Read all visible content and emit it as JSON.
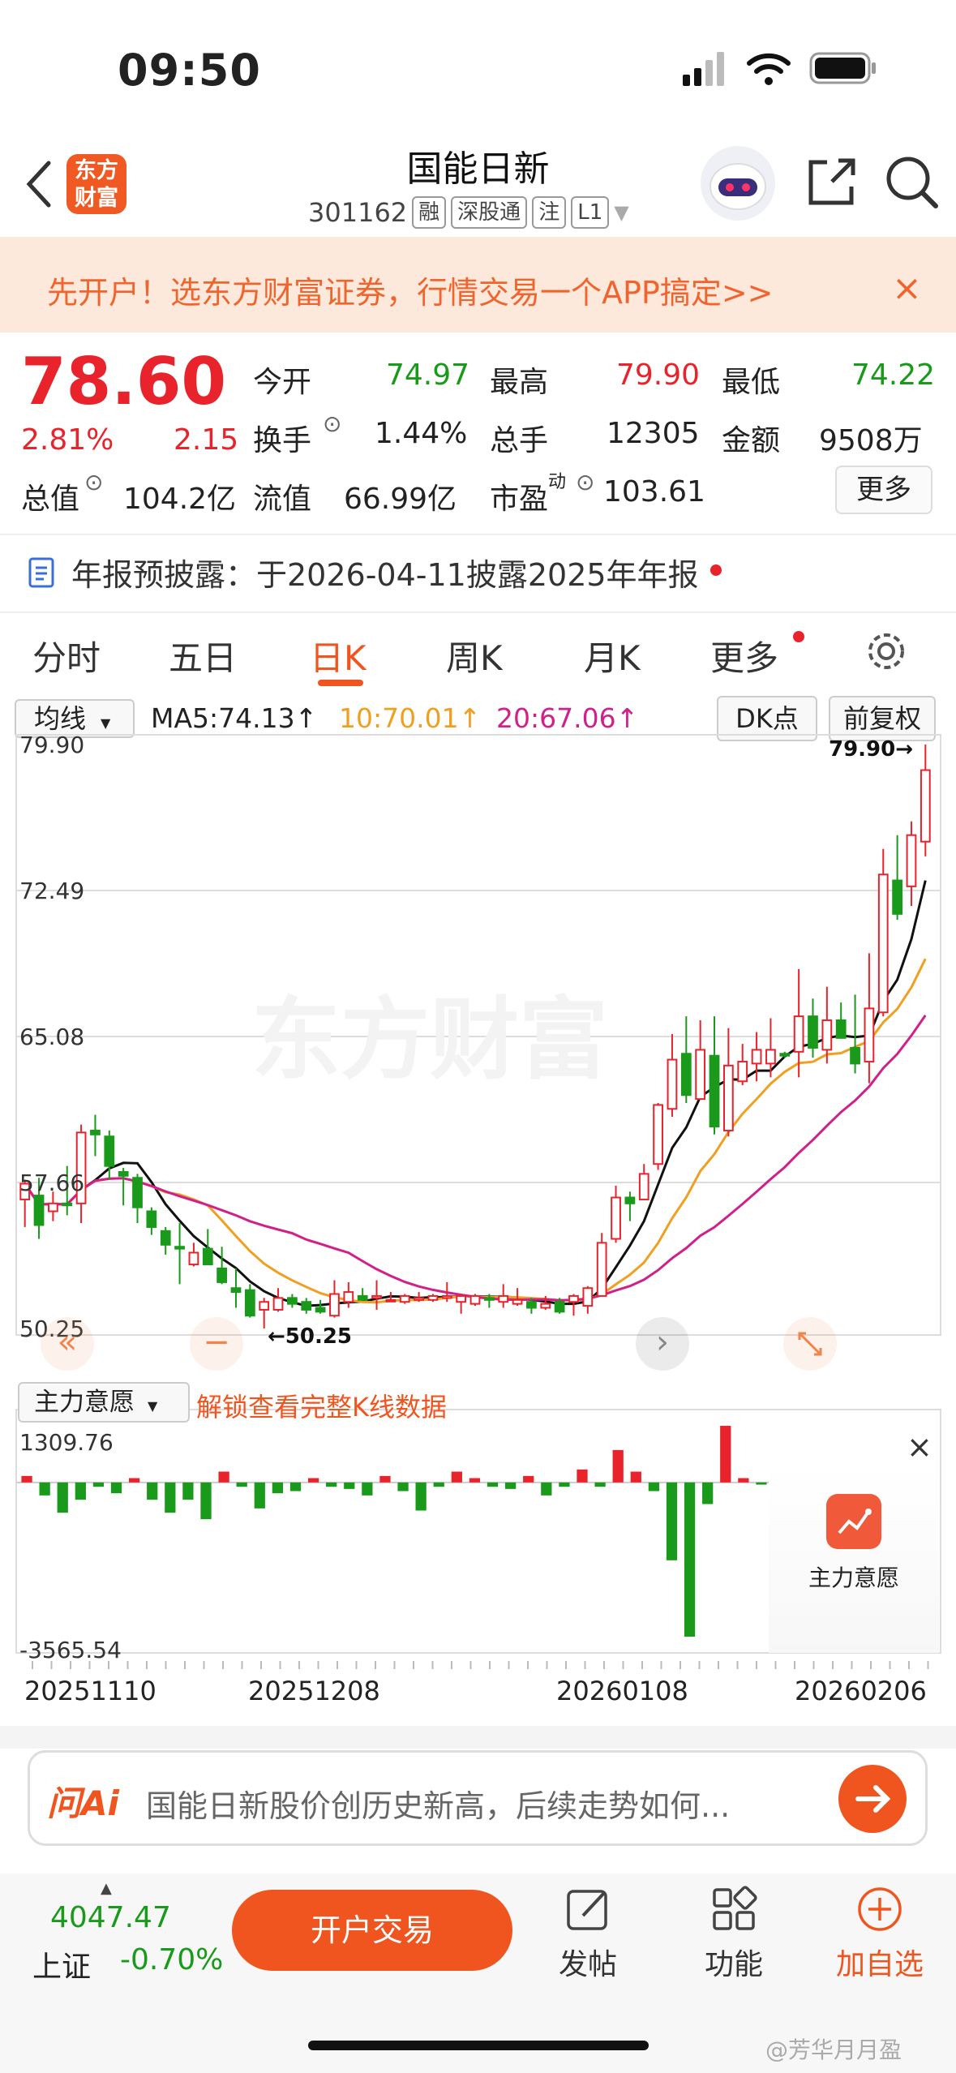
{
  "status": {
    "time": "09:50"
  },
  "header": {
    "title": "国能日新",
    "code": "301162",
    "tags": [
      "融",
      "深股通",
      "注",
      "L1"
    ],
    "logo": "东方\n财富"
  },
  "banner": {
    "text": "先开户！选东方财富证券，行情交易一个APP搞定>>",
    "close": "×"
  },
  "quote": {
    "price": "78.60",
    "pct": "2.81%",
    "chg": "2.15",
    "open_label": "今开",
    "open": "74.97",
    "high_label": "最高",
    "high": "79.90",
    "low_label": "最低",
    "low": "74.22",
    "turnover_label": "换手",
    "turnover": "1.44%",
    "vol_label": "总手",
    "vol": "12305",
    "amount_label": "金额",
    "amount": "9508万",
    "cap_label": "总值",
    "cap": "104.2亿",
    "float_label": "流值",
    "float": "66.99亿",
    "pe_label": "市盈",
    "pe_sup": "动",
    "pe": "103.61",
    "more": "更多"
  },
  "notice": {
    "text": "年报预披露：于2026-04-11披露2025年年报"
  },
  "tabs": [
    "分时",
    "五日",
    "日K",
    "周K",
    "月K",
    "更多"
  ],
  "active_tab": "日K",
  "ma": {
    "select": "均线",
    "ma5": "MA5:74.13↑",
    "ma10": "10:70.01↑",
    "ma20": "20:67.06↑",
    "dk": "DK点",
    "fq": "前复权"
  },
  "axis": {
    "y_labels": [
      "79.90",
      "72.49",
      "65.08",
      "57.66",
      "50.25"
    ],
    "max_mark": "79.90→",
    "min_mark": "←50.25"
  },
  "watermark": "东方财富",
  "sub": {
    "select": "主力意愿",
    "unlock": "解锁查看完整K线数据",
    "top": "1309.76",
    "bottom": "-3565.54",
    "badge": "主力意愿",
    "close": "×"
  },
  "dates": [
    "20251110",
    "20251208",
    "20260108",
    "20260206"
  ],
  "ai": {
    "brand": "问Ai",
    "text": "国能日新股价创历史新高，后续走势如何..."
  },
  "footer": {
    "index": "4047.47",
    "index_name": "上证",
    "index_pct": "-0.70%",
    "trade": "开户交易",
    "post": "发帖",
    "func": "功能",
    "add": "加自选"
  },
  "credit": "@芳华月月盈",
  "colors": {
    "up": "#e8232b",
    "down": "#1a9a1a",
    "accent": "#f0551f",
    "ma5": "#111111",
    "ma10": "#f0a020",
    "ma20": "#d0208a"
  },
  "chart_data": {
    "type": "candlestick",
    "ylim": [
      50.25,
      79.9
    ],
    "candles": [
      [
        56.8,
        57.6,
        55.4,
        57.8
      ],
      [
        57.0,
        55.5,
        54.8,
        57.9
      ],
      [
        56.2,
        56.6,
        55.7,
        57.2
      ],
      [
        56.6,
        56.5,
        56.0,
        58.5
      ],
      [
        56.6,
        60.2,
        55.6,
        60.6
      ],
      [
        60.3,
        60.1,
        59.0,
        61.1
      ],
      [
        60.0,
        58.5,
        57.8,
        60.3
      ],
      [
        58.2,
        58.0,
        56.5,
        58.4
      ],
      [
        57.9,
        56.4,
        55.6,
        58.1
      ],
      [
        56.2,
        55.4,
        55.0,
        56.4
      ],
      [
        55.2,
        54.5,
        54.0,
        55.4
      ],
      [
        54.4,
        54.3,
        52.5,
        55.6
      ],
      [
        53.5,
        54.1,
        53.4,
        54.6
      ],
      [
        54.3,
        53.5,
        53.5,
        55.3
      ],
      [
        53.3,
        52.6,
        52.5,
        54.4
      ],
      [
        52.3,
        52.1,
        51.3,
        53.3
      ],
      [
        52.2,
        50.9,
        50.8,
        52.5
      ],
      [
        51.2,
        51.6,
        50.25,
        51.8
      ],
      [
        51.2,
        51.8,
        51.1,
        52.3
      ],
      [
        51.8,
        51.5,
        51.3,
        52.0
      ],
      [
        51.6,
        51.2,
        51.0,
        51.8
      ],
      [
        51.3,
        51.1,
        51.0,
        51.7
      ],
      [
        50.9,
        52.0,
        50.8,
        52.7
      ],
      [
        51.6,
        52.1,
        51.3,
        52.6
      ],
      [
        51.9,
        51.7,
        51.7,
        52.3
      ],
      [
        51.8,
        51.9,
        51.2,
        52.7
      ],
      [
        51.7,
        51.7,
        51.6,
        52.1
      ],
      [
        51.6,
        51.9,
        51.5,
        52.0
      ],
      [
        51.7,
        51.8,
        51.6,
        52.1
      ],
      [
        51.7,
        51.9,
        51.6,
        52.0
      ],
      [
        51.8,
        51.9,
        51.6,
        52.6
      ],
      [
        51.6,
        51.9,
        51.0,
        52.0
      ],
      [
        51.5,
        51.9,
        51.4,
        52.0
      ],
      [
        51.8,
        51.7,
        51.3,
        52.0
      ],
      [
        51.6,
        51.9,
        51.3,
        52.5
      ],
      [
        51.5,
        51.7,
        51.4,
        52.3
      ],
      [
        51.6,
        51.3,
        51.0,
        51.8
      ],
      [
        51.3,
        51.5,
        51.2,
        51.9
      ],
      [
        51.6,
        51.1,
        51.0,
        51.8
      ],
      [
        51.6,
        51.9,
        50.9,
        52.0
      ],
      [
        51.4,
        52.3,
        51.0,
        52.4
      ],
      [
        51.9,
        54.6,
        51.9,
        55.1
      ],
      [
        54.8,
        56.9,
        54.6,
        57.5
      ],
      [
        56.9,
        56.6,
        55.7,
        57.2
      ],
      [
        56.8,
        58.1,
        57.4,
        58.6
      ],
      [
        58.6,
        61.6,
        58.3,
        61.7
      ],
      [
        61.4,
        63.9,
        61.0,
        65.2
      ],
      [
        64.2,
        62.1,
        61.7,
        66.1
      ],
      [
        61.9,
        64.4,
        63.0,
        65.9
      ],
      [
        64.1,
        60.5,
        60.1,
        66.1
      ],
      [
        60.3,
        63.6,
        60.0,
        65.5
      ],
      [
        62.8,
        63.8,
        62.6,
        64.7
      ],
      [
        63.7,
        64.4,
        62.8,
        65.3
      ],
      [
        63.7,
        64.4,
        63.0,
        66.0
      ],
      [
        64.2,
        64.1,
        64.0,
        64.3
      ],
      [
        64.3,
        66.1,
        63.0,
        68.5
      ],
      [
        66.1,
        64.5,
        64.0,
        67.0
      ],
      [
        64.4,
        65.9,
        63.7,
        67.6
      ],
      [
        65.9,
        65.0,
        65.0,
        66.8
      ],
      [
        64.5,
        63.7,
        63.2,
        67.2
      ],
      [
        63.8,
        66.5,
        62.7,
        69.3
      ],
      [
        66.3,
        73.3,
        66.1,
        74.6
      ],
      [
        73.0,
        71.3,
        71.0,
        75.3
      ],
      [
        72.7,
        75.3,
        71.7,
        76.0
      ],
      [
        74.97,
        78.6,
        74.22,
        79.9
      ]
    ],
    "ma5_end": 74.13,
    "ma10_end": 70.01,
    "ma20_end": 67.06,
    "sub_values": [
      150,
      -300,
      -700,
      -400,
      -100,
      -250,
      100,
      -400,
      -700,
      -400,
      -850,
      250,
      -100,
      -600,
      -250,
      -200,
      100,
      -100,
      -150,
      -300,
      150,
      -200,
      -650,
      -100,
      250,
      100,
      -100,
      -150,
      150,
      -300,
      -100,
      300,
      -100,
      750,
      250,
      -200,
      -1800,
      -3565,
      -500,
      1309,
      100,
      -50
    ],
    "x_labels": [
      "20251110",
      "20251208",
      "20260108",
      "20260206"
    ]
  }
}
